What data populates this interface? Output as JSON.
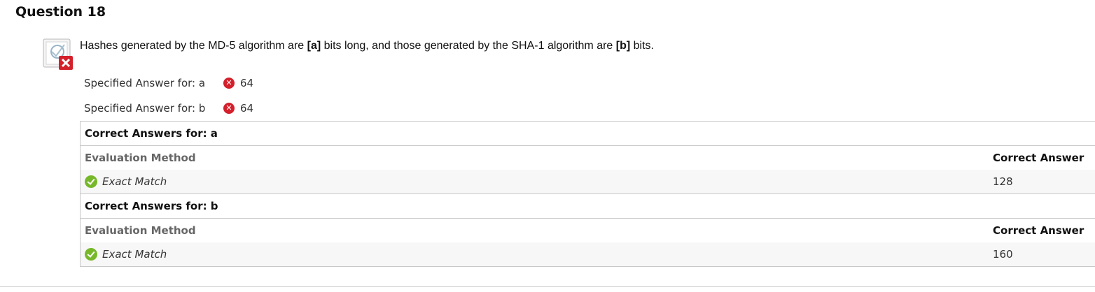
{
  "question": {
    "title": "Question 18",
    "status_icon": "incorrect-icon",
    "text_part1": "Hashes generated by the MD-5 algorithm are ",
    "blank_a": "[a]",
    "text_part2": " bits long, and those generated by the SHA-1 algorithm are ",
    "blank_b": "[b]",
    "text_part3": " bits."
  },
  "specified_answers": [
    {
      "label": "Specified Answer for: a",
      "status_icon": "incorrect-icon",
      "value": "64"
    },
    {
      "label": "Specified Answer for: b",
      "status_icon": "incorrect-icon",
      "value": "64"
    }
  ],
  "correct_answers": [
    {
      "heading": "Correct Answers for: a",
      "col_method": "Evaluation Method",
      "col_answer": "Correct Answer",
      "method_icon": "check-icon",
      "method": "Exact Match",
      "answer": "128"
    },
    {
      "heading": "Correct Answers for: b",
      "col_method": "Evaluation Method",
      "col_answer": "Correct Answer",
      "method_icon": "check-icon",
      "method": "Exact Match",
      "answer": "160"
    }
  ],
  "colors": {
    "incorrect": "#d3202b",
    "correct": "#77b82a",
    "border": "#c8c8c8"
  }
}
